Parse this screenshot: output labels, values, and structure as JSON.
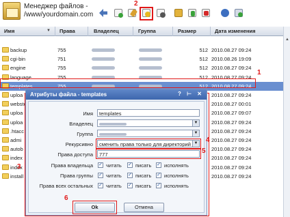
{
  "app": {
    "title_line1": "Менеджер файлов -",
    "title_line2": "/www/yourdomain.com"
  },
  "callouts": {
    "c1": "1",
    "c2": "2",
    "c3": "3",
    "c4": "4",
    "c5": "5",
    "c6": "6"
  },
  "columns": {
    "name": "Имя",
    "perms": "Права",
    "owner": "Владелец",
    "group": "Группа",
    "size": "Размер",
    "modified": "Дата изменения"
  },
  "rows": [
    {
      "name": "backup",
      "perms": "755",
      "size": "512",
      "date": "2010.08.27 09:24"
    },
    {
      "name": "cgi-bin",
      "perms": "751",
      "size": "512",
      "date": "2010.08.26 19:09"
    },
    {
      "name": "engine",
      "perms": "755",
      "size": "512",
      "date": "2010.08.27 09:24"
    },
    {
      "name": "language",
      "perms": "755",
      "size": "512",
      "date": "2010.08.27 09:24"
    },
    {
      "name": "templates",
      "perms": "755",
      "size": "512",
      "date": "2010.08.27 09:24"
    },
    {
      "name": "uploa",
      "perms": "",
      "size": "",
      "date": "2010.08.27 09:24"
    },
    {
      "name": "webste",
      "perms": "",
      "size": "",
      "date": "2010.08.27 00:01"
    },
    {
      "name": "uploa",
      "perms": "",
      "size": "",
      "date": "2010.08.27 09:07"
    },
    {
      "name": "uploa",
      "perms": "",
      "size": "",
      "date": "2010.08.27 09:24"
    },
    {
      "name": ".htacc",
      "perms": "",
      "size": "",
      "date": "2010.08.27 09:24"
    },
    {
      "name": "admi",
      "perms": "",
      "size": "",
      "date": "2010.08.27 09:24"
    },
    {
      "name": "autob",
      "perms": "",
      "size": "",
      "date": "2010.08.27 09:24"
    },
    {
      "name": "index",
      "perms": "",
      "size": "",
      "date": "2010.08.27 09:24"
    },
    {
      "name": "index",
      "perms": "",
      "size": "",
      "date": "2010.08.27 09:24"
    },
    {
      "name": "install",
      "perms": "",
      "size": "",
      "date": "2010.08.27 09:24"
    }
  ],
  "dialog": {
    "title": "Атрибуты файла - templates",
    "title_buttons": "? ⊢ ✕",
    "name_label": "Имя",
    "name_value": "templates",
    "owner_label": "Владелец",
    "group_label": "Группа",
    "recursive_label": "Рекурсивно",
    "recursive_value": "сменить права только для директорий",
    "perms_label": "Права доступа",
    "perms_value": "777",
    "owner_rights_label": "Права владельца",
    "group_rights_label": "Права группы",
    "others_rights_label": "Права всех остальных",
    "read_label": "читать",
    "write_label": "писать",
    "exec_label": "исполнять",
    "ok_label": "Ok",
    "cancel_label": "Отмена"
  },
  "colors": {
    "accent_red": "#e01818",
    "selection": "#6a8fd0",
    "title_bar": "#3d66ad"
  }
}
